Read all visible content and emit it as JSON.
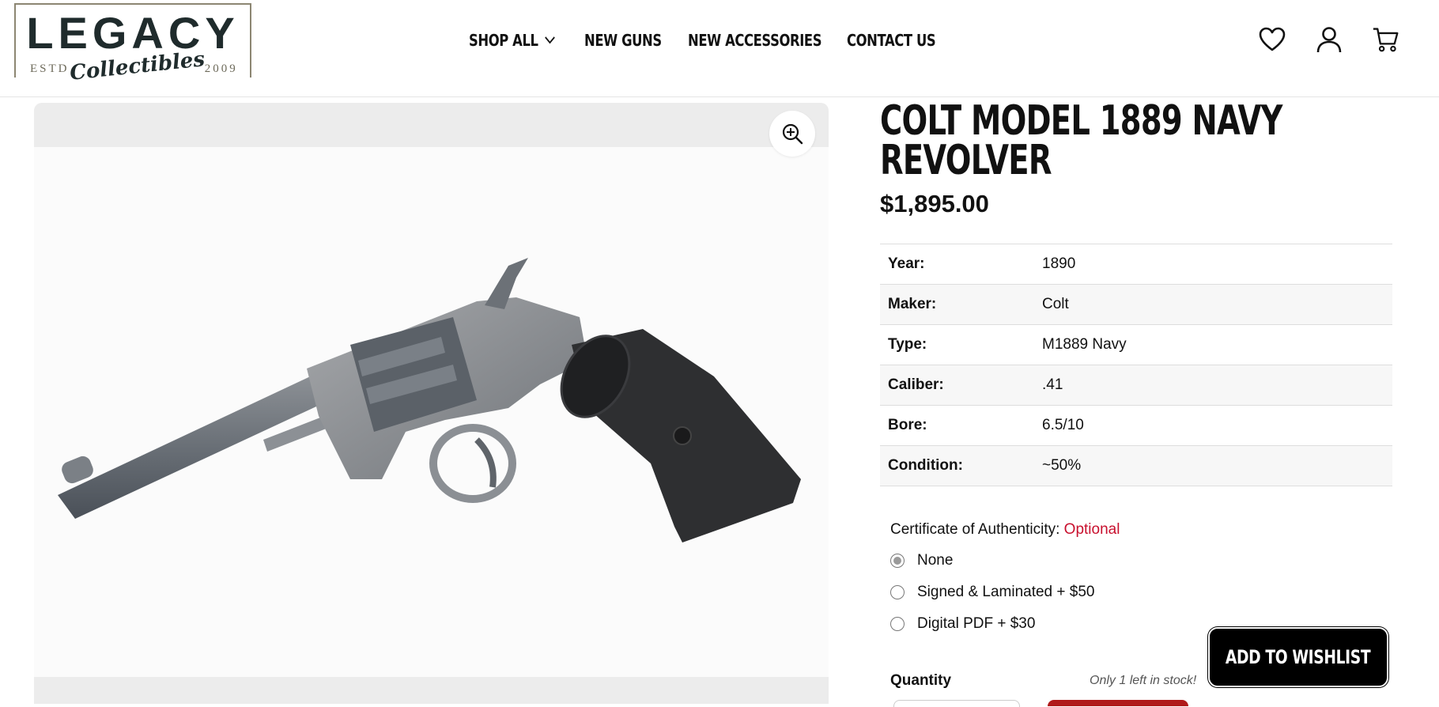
{
  "logo": {
    "main": "LEGACY",
    "estd": "ESTD",
    "script": "Collectibles",
    "year": "2009"
  },
  "nav": {
    "items": [
      {
        "label": "SHOP ALL",
        "has_dropdown": true
      },
      {
        "label": "NEW GUNS"
      },
      {
        "label": "NEW ACCESSORIES"
      },
      {
        "label": "CONTACT US"
      }
    ]
  },
  "header_icons": [
    "heart-icon",
    "user-icon",
    "cart-icon"
  ],
  "gallery": {
    "zoom_icon": "zoom-in-icon",
    "image_alt": "revolver photo"
  },
  "product": {
    "title": "COLT MODEL 1889 NAVY REVOLVER",
    "price": "$1,895.00",
    "specs": [
      {
        "key": "Year:",
        "value": "1890"
      },
      {
        "key": "Maker:",
        "value": "Colt"
      },
      {
        "key": "Type:",
        "value": "M1889 Navy"
      },
      {
        "key": "Caliber:",
        "value": ".41"
      },
      {
        "key": "Bore:",
        "value": "6.5/10"
      },
      {
        "key": "Condition:",
        "value": "~50%"
      }
    ]
  },
  "certificate": {
    "label": "Certificate of Authenticity:",
    "optional": "Optional",
    "options": [
      {
        "label": "None",
        "checked": true
      },
      {
        "label": "Signed & Laminated + $50",
        "checked": false
      },
      {
        "label": "Digital PDF + $30",
        "checked": false
      }
    ]
  },
  "quantity": {
    "label": "Quantity",
    "stock": "Only 1 left in stock!"
  },
  "wishlist_label": "ADD TO WISHLIST",
  "colors": {
    "accent_red": "#c8102e",
    "logo_dark": "#1f2b2c",
    "logo_border": "#8c8672",
    "button_bg": "#000000",
    "cart_red": "#b01a1a"
  }
}
